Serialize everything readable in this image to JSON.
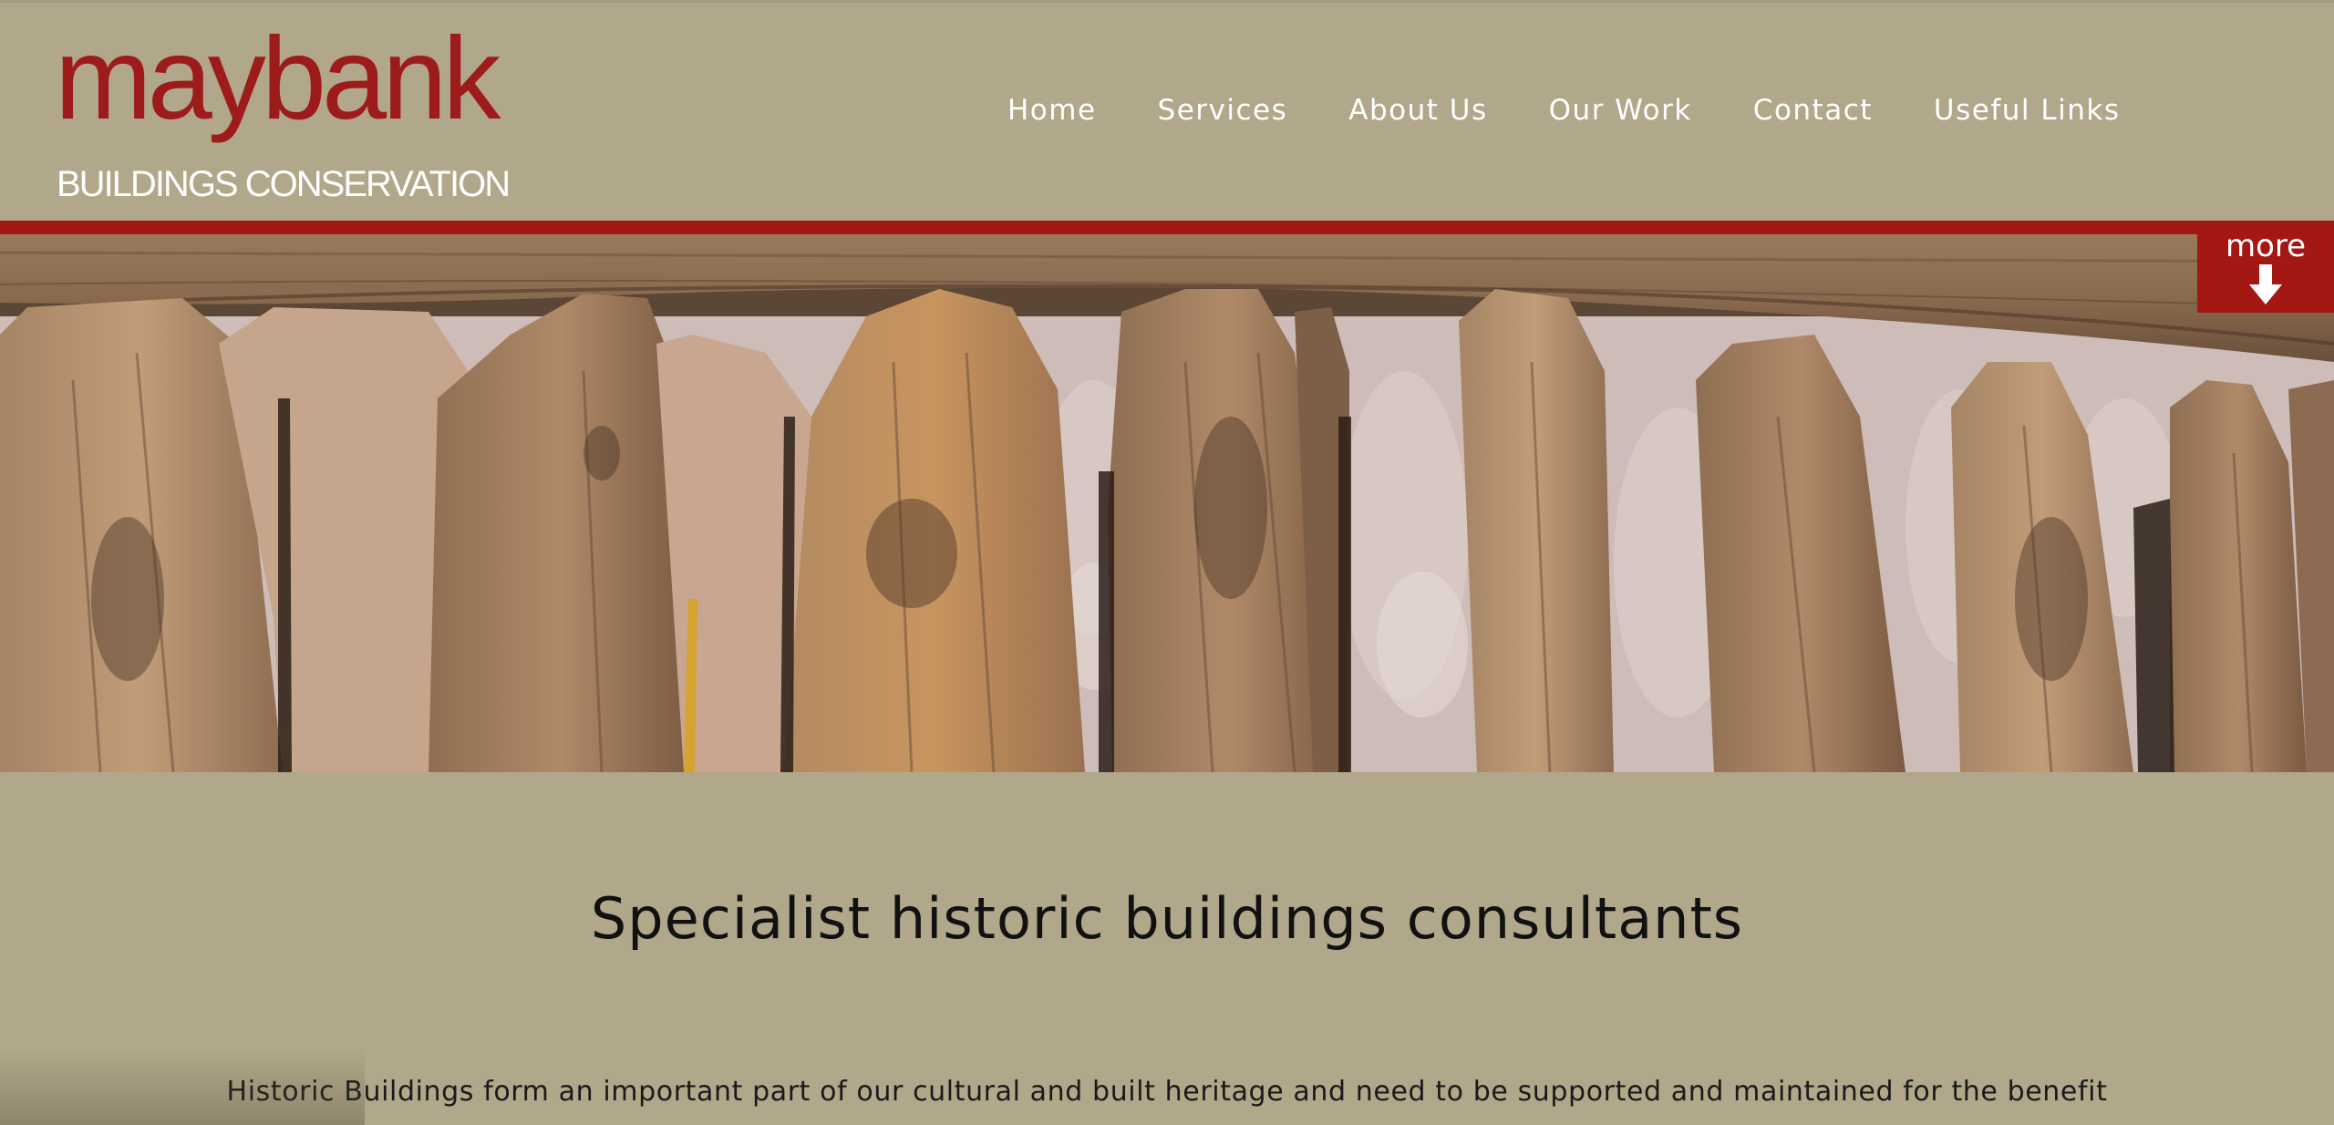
{
  "brand": {
    "logo_word": "maybank",
    "logo_subtitle": "BUILDINGS CONSERVATION",
    "accent_color": "#a31812",
    "background_color": "#b1a78a"
  },
  "nav": {
    "items": [
      {
        "label": "Home"
      },
      {
        "label": "Services"
      },
      {
        "label": "About Us"
      },
      {
        "label": "Our Work"
      },
      {
        "label": "Contact"
      },
      {
        "label": "Useful Links"
      }
    ]
  },
  "hero": {
    "more_label": "more",
    "more_icon": "arrow-down-icon"
  },
  "content": {
    "headline": "Specialist historic buildings consultants",
    "intro": "Historic Buildings form an important part of our cultural and built heritage and need to be supported and maintained for the benefit"
  }
}
